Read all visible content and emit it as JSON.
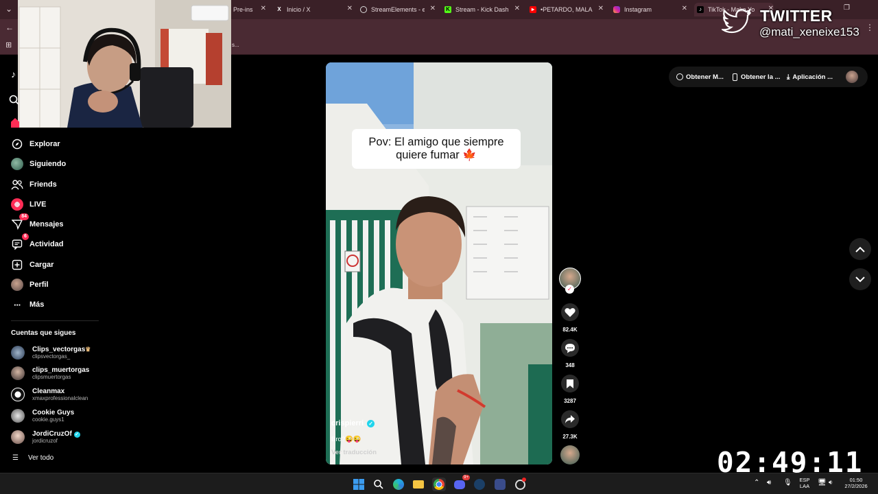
{
  "browser": {
    "tabs": [
      {
        "label": "Pre-ins",
        "icon": "tab-favicon"
      },
      {
        "label": "Inicio / X",
        "icon": "x-icon"
      },
      {
        "label": "StreamElements - ele",
        "icon": "streamelements-icon"
      },
      {
        "label": "Stream - Kick Dashbo",
        "icon": "kick-icon"
      },
      {
        "label": "•PETARDO, MALARDO",
        "icon": "youtube-icon"
      },
      {
        "label": "Instagram",
        "icon": "instagram-icon"
      },
      {
        "label": "TikTok - Make Yo",
        "icon": "tiktok-icon"
      }
    ],
    "bookmark_fragment": "s..."
  },
  "overlay": {
    "twitter_title": "TWITTER",
    "twitter_handle": "@mati_xeneixe153",
    "timer": "02:49:11"
  },
  "sidebar": {
    "nav": [
      {
        "label": "Explorar",
        "icon": "compass-icon"
      },
      {
        "label": "Siguiendo",
        "icon": "following-avatar-icon"
      },
      {
        "label": "Friends",
        "icon": "friends-icon"
      },
      {
        "label": "LIVE",
        "icon": "live-icon"
      },
      {
        "label": "Mensajes",
        "icon": "messages-icon",
        "badge": "84"
      },
      {
        "label": "Actividad",
        "icon": "activity-icon",
        "badge": "6"
      },
      {
        "label": "Cargar",
        "icon": "upload-icon"
      },
      {
        "label": "Perfil",
        "icon": "profile-avatar-icon"
      },
      {
        "label": "Más",
        "icon": "more-icon"
      }
    ],
    "following_heading": "Cuentas que sigues",
    "accounts": [
      {
        "name": "Clips_vectorgas",
        "handle": "clipsvectorgas_",
        "crown": true
      },
      {
        "name": "clips_muertorgas",
        "handle": "clipsmuertorgas"
      },
      {
        "name": "Cleanmax",
        "handle": "xmaxprofessionalclean"
      },
      {
        "name": "Cookie Guys",
        "handle": "cookie.guys1"
      },
      {
        "name": "JordiCruzOf",
        "handle": "jordicruzof",
        "verified": true
      }
    ],
    "see_all": "Ver todo"
  },
  "video": {
    "caption_line1": "Pov: El amigo que siempre",
    "caption_line2": "quiere fumar",
    "author": "crispierri",
    "description": "Bro?😜😜",
    "translate": "Ver traducción"
  },
  "actions": {
    "likes": "82.4K",
    "comments": "348",
    "saves": "3287",
    "shares": "27.3K"
  },
  "top_bar": {
    "get_m": "Obtener M...",
    "get_app": "Obtener la ...",
    "app": "Aplicación ..."
  },
  "taskbar": {
    "lang1": "ESP",
    "lang2": "LAA",
    "time": "01:50",
    "date": "27/2/2026",
    "discord_badge": "9+"
  },
  "colors": {
    "tab_bar": "#3a2027",
    "toolbar": "#4a2a33",
    "tiktok_red": "#fe2c55",
    "verified": "#20d5ec"
  }
}
